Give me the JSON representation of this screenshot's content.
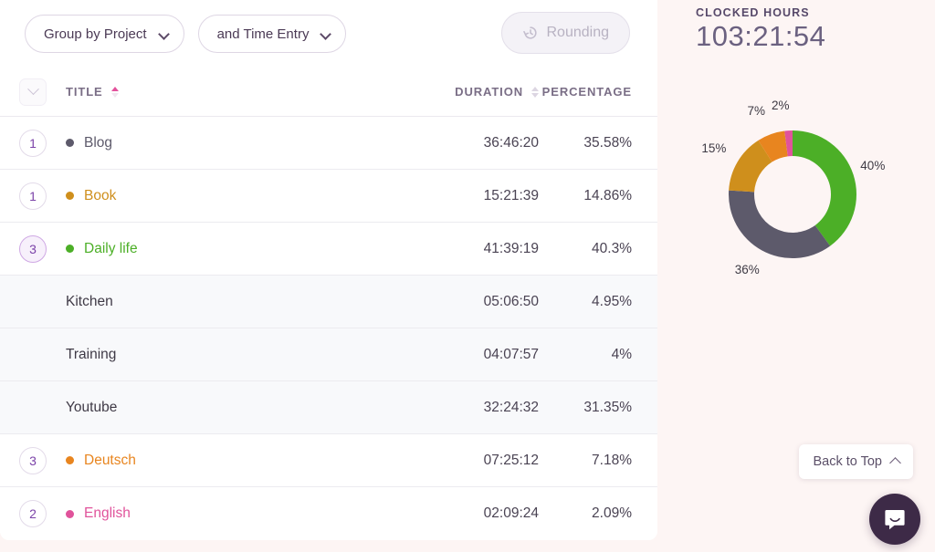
{
  "toolbar": {
    "group_by": "Group by Project",
    "and_entry": "and Time Entry",
    "rounding": "Rounding",
    "rounding_icon": "history-rounding-icon"
  },
  "table": {
    "headers": {
      "title": "TITLE",
      "duration": "DURATION",
      "percentage": "PERCENTAGE"
    },
    "rows": [
      {
        "count": "1",
        "title": "Blog",
        "duration": "36:46:20",
        "percentage": "35.58%",
        "color": "#5d5a6b",
        "child": false,
        "expanded": false
      },
      {
        "count": "1",
        "title": "Book",
        "duration": "15:21:39",
        "percentage": "14.86%",
        "color": "#cf8f1c",
        "child": false,
        "expanded": false
      },
      {
        "count": "3",
        "title": "Daily life",
        "duration": "41:39:19",
        "percentage": "40.3%",
        "color": "#4caf27",
        "child": false,
        "expanded": true
      },
      {
        "count": "",
        "title": "Kitchen",
        "duration": "05:06:50",
        "percentage": "4.95%",
        "color": "",
        "child": true,
        "expanded": false
      },
      {
        "count": "",
        "title": "Training",
        "duration": "04:07:57",
        "percentage": "4%",
        "color": "",
        "child": true,
        "expanded": false
      },
      {
        "count": "",
        "title": "Youtube",
        "duration": "32:24:32",
        "percentage": "31.35%",
        "color": "",
        "child": true,
        "expanded": false
      },
      {
        "count": "3",
        "title": "Deutsch",
        "duration": "07:25:12",
        "percentage": "7.18%",
        "color": "#e8851f",
        "child": false,
        "expanded": false
      },
      {
        "count": "2",
        "title": "English",
        "duration": "02:09:24",
        "percentage": "2.09%",
        "color": "#e0539b",
        "child": false,
        "expanded": false
      }
    ]
  },
  "summary": {
    "clocked_hours_label": "CLOCKED HOURS",
    "clocked_hours_value": "103:21:54"
  },
  "chart_data": {
    "type": "pie",
    "title": "CLOCKED HOURS",
    "subtitle": "103:21:54",
    "donut": true,
    "inner_radius_ratio": 0.6,
    "legend": "none",
    "labels_outside": true,
    "categories": [
      "Daily life",
      "Blog",
      "Book",
      "Deutsch",
      "English"
    ],
    "values": [
      40,
      36,
      15,
      7,
      2
    ],
    "value_labels": [
      "40%",
      "36%",
      "15%",
      "7%",
      "2%"
    ],
    "colors": [
      "#4caf27",
      "#5d5a6b",
      "#cf8f1c",
      "#e8851f",
      "#e0539b"
    ],
    "durations": [
      "41:39:19",
      "36:46:20",
      "15:21:39",
      "07:25:12",
      "02:09:24"
    ],
    "exact_percentages": [
      40.3,
      35.58,
      14.86,
      7.18,
      2.09
    ],
    "start_angle_deg": 0,
    "direction": "clockwise"
  },
  "overlays": {
    "back_to_top": "Back to Top",
    "back_to_top_icon": "chevron-up-icon",
    "chat_icon": "intercom-chat-icon"
  },
  "colors": {
    "page_bg": "#fdf5f4",
    "card_bg": "#ffffff",
    "child_row_bg": "#f8f9fb",
    "accent": "#7b42a8",
    "sort_active": "#e3529c"
  }
}
